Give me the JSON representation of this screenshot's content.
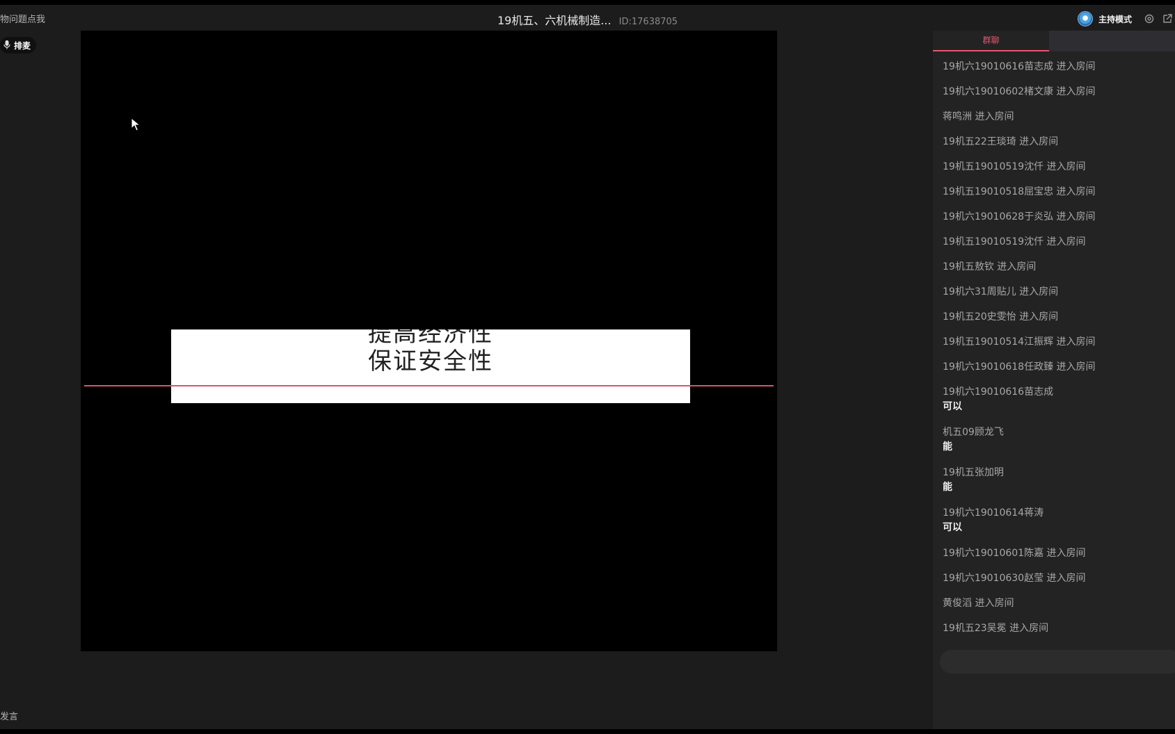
{
  "header": {
    "help_link": "物问题点我",
    "title": "19机五、六机械制造...",
    "room_id": "ID:17638705",
    "host_mode": "主持模式"
  },
  "toolbar": {
    "queue_label": "排麦"
  },
  "footer": {
    "left_label": "发言"
  },
  "slide": {
    "line_partial": "提高经济性",
    "line_main": "保证安全性"
  },
  "chat": {
    "tabs": [
      "群聊",
      ""
    ],
    "items": [
      {
        "name": "19机六19010616苗志成",
        "text": "进入房间"
      },
      {
        "name": "19机六19010602楮文康",
        "text": "进入房间"
      },
      {
        "name": "蒋鸣洲",
        "text": "进入房间"
      },
      {
        "name": "19机五22王琰琦",
        "text": "进入房间"
      },
      {
        "name": "19机五19010519沈仟",
        "text": "进入房间"
      },
      {
        "name": "19机五19010518屈宝忠",
        "text": "进入房间"
      },
      {
        "name": "19机六19010628于炎弘",
        "text": "进入房间"
      },
      {
        "name": "19机五19010519沈仟",
        "text": "进入房间"
      },
      {
        "name": "19机五敖钦",
        "text": "进入房间"
      },
      {
        "name": "19机六31周贴儿",
        "text": "进入房间"
      },
      {
        "name": "19机五20史雯怡",
        "text": "进入房间"
      },
      {
        "name": "19机五19010514江振辉",
        "text": "进入房间"
      },
      {
        "name": "19机六19010618任政臻",
        "text": "进入房间"
      },
      {
        "name": "19机六19010616苗志成",
        "message": "可以"
      },
      {
        "name": "机五09顾龙飞",
        "message": "能"
      },
      {
        "name": "19机五张加明",
        "message": "能"
      },
      {
        "name": "19机六19010614蒋涛",
        "message": "可以"
      },
      {
        "name": "19机六19010601陈嘉",
        "text": "进入房间"
      },
      {
        "name": "19机六19010630赵莹",
        "text": "进入房间"
      },
      {
        "name": "黄俊滔",
        "text": "进入房间"
      },
      {
        "name": "19机五23吴冕",
        "text": "进入房间"
      }
    ]
  },
  "colors": {
    "accent": "#e8556f",
    "background": "#1c1c1c",
    "stage": "#000000"
  }
}
